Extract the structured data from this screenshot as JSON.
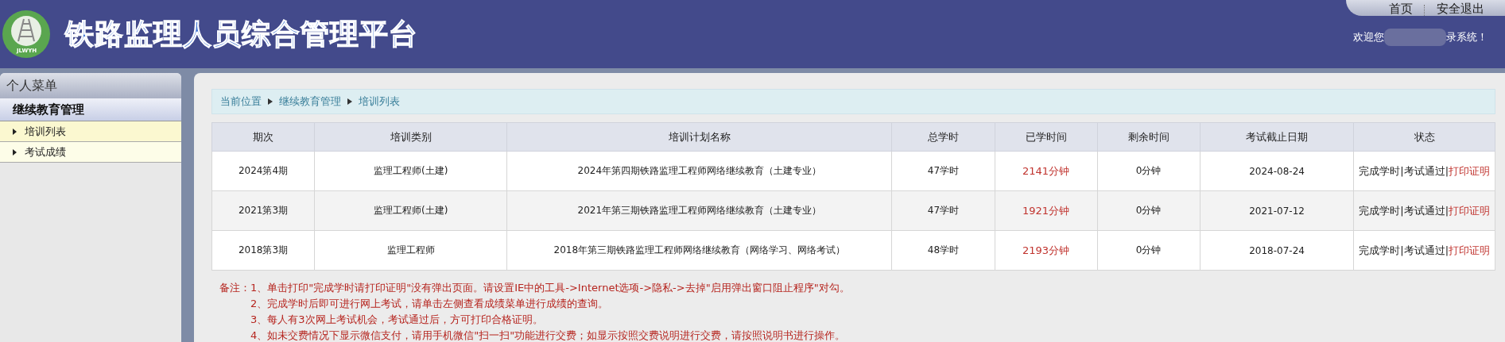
{
  "header": {
    "title": "铁路监理人员综合管理平台",
    "logo_text": "JLWYH",
    "nav": [
      "首页",
      "安全退出"
    ],
    "welcome_start": "欢迎您",
    "welcome_end": "录系统！"
  },
  "sidebar": {
    "title": "个人菜单",
    "group": "继续教育管理",
    "items": [
      {
        "label": "培训列表",
        "selected": true
      },
      {
        "label": "考试成绩",
        "selected": false
      }
    ]
  },
  "breadcrumb": [
    "当前位置",
    "继续教育管理",
    "培训列表"
  ],
  "table": {
    "columns": [
      "期次",
      "培训类别",
      "培训计划名称",
      "总学时",
      "已学时间",
      "剩余时间",
      "考试截止日期",
      "状态"
    ],
    "rows": [
      {
        "period": "2024第4期",
        "category": "监理工程师(土建)",
        "plan": "2024年第四期铁路监理工程师网络继续教育（土建专业）",
        "total": "47学时",
        "learned": "2141分钟",
        "remaining": "0分钟",
        "deadline": "2024-08-24",
        "status": "完成学时|考试通过|",
        "link": "打印证明"
      },
      {
        "period": "2021第3期",
        "category": "监理工程师(土建)",
        "plan": "2021年第三期铁路监理工程师网络继续教育（土建专业）",
        "total": "47学时",
        "learned": "1921分钟",
        "remaining": "0分钟",
        "deadline": "2021-07-12",
        "status": "完成学时|考试通过|",
        "link": "打印证明"
      },
      {
        "period": "2018第3期",
        "category": "监理工程师",
        "plan": "2018年第三期铁路监理工程师网络继续教育（网络学习、网络考试）",
        "total": "48学时",
        "learned": "2193分钟",
        "remaining": "0分钟",
        "deadline": "2018-07-24",
        "status": "完成学时|考试通过|",
        "link": "打印证明"
      }
    ]
  },
  "notes": {
    "label": "备注：",
    "items": [
      "1、单击打印\"完成学时请打印证明\"没有弹出页面。请设置IE中的工具->Internet选项->隐私->去掉\"启用弹出窗口阻止程序\"对勾。",
      "2、完成学时后即可进行网上考试，请单击左侧查看成绩菜单进行成绩的查询。",
      "3、每人有3次网上考试机会，考试通过后，方可打印合格证明。",
      "4、如未交费情况下显示微信支付，请用手机微信\"扫一扫\"功能进行交费；如显示按照交费说明进行交费，请按照说明书进行操作。"
    ]
  }
}
